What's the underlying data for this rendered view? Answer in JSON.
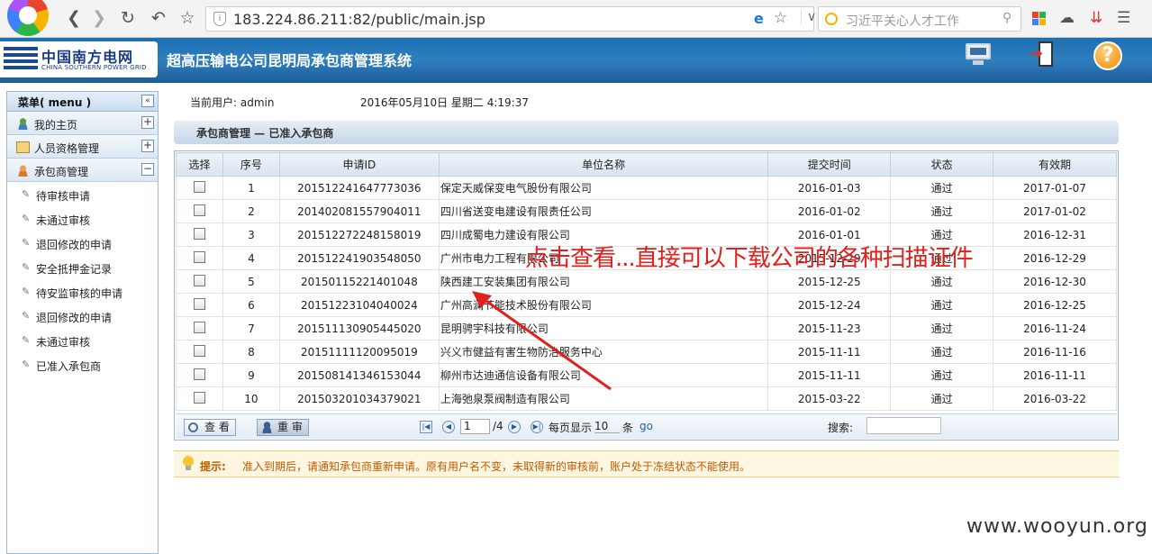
{
  "browser": {
    "url": "183.224.86.211:82/public/main.jsp",
    "search_placeholder": "习近平关心人才工作",
    "nav_back": "❮",
    "nav_forward": "❯",
    "nav_reload": "↻",
    "nav_undo": "↶",
    "nav_fav": "☆",
    "ie_mark": "e",
    "star": "☆",
    "dropdown": "∨",
    "tool_cloud": "☁",
    "tool_down": "⇊",
    "tool_menu": "☰",
    "search_mag": "⚲"
  },
  "header": {
    "brand_cn": "中国南方电网",
    "brand_en": "CHINA SOUTHERN POWER GRID",
    "system_title": "超高压输电公司昆明局承包商管理系统",
    "help_label": "?"
  },
  "sidebar": {
    "title": "菜单( menu )",
    "collapse_label": "«",
    "sections": [
      {
        "label": "我的主页",
        "toggle": "+"
      },
      {
        "label": "人员资格管理",
        "toggle": "+"
      },
      {
        "label": "承包商管理",
        "toggle": "−"
      }
    ],
    "items": [
      "待审核申请",
      "未通过审核",
      "退回修改的申请",
      "安全抵押金记录",
      "待安监审核的申请",
      "退回修改的申请",
      "未通过审核",
      "已准入承包商"
    ],
    "item_icon": "✎"
  },
  "main": {
    "current_user": "当前用户: admin",
    "datetime": "2016年05月10日 星期二 4:19:37",
    "breadcrumb": "承包商管理 — 已准入承包商",
    "columns": [
      "选择",
      "序号",
      "申请ID",
      "单位名称",
      "提交时间",
      "状态",
      "有效期"
    ],
    "rows": [
      {
        "no": "1",
        "id": "201512241647773036",
        "name": "保定天威保变电气股份有限公司",
        "submitted": "2016-01-03",
        "status": "通过",
        "valid": "2017-01-07"
      },
      {
        "no": "2",
        "id": "201402081557904011",
        "name": "四川省送变电建设有限责任公司",
        "submitted": "2016-01-02",
        "status": "通过",
        "valid": "2017-01-02"
      },
      {
        "no": "3",
        "id": "201512272248158019",
        "name": "四川成蜀电力建设有限公司",
        "submitted": "2016-01-01",
        "status": "通过",
        "valid": "2016-12-31"
      },
      {
        "no": "4",
        "id": "201512241903548050",
        "name": "广州市电力工程有限公司",
        "submitted": "2015-12-29",
        "status": "通过",
        "valid": "2016-12-29"
      },
      {
        "no": "5",
        "id": "2015011522140104 8",
        "name": "陕西建工安装集团有限公司",
        "submitted": "2015-12-25",
        "status": "通过",
        "valid": "2016-12-30"
      },
      {
        "no": "6",
        "id": "20151223104040024",
        "name": "广州高澜节能技术股份有限公司",
        "submitted": "2015-12-24",
        "status": "通过",
        "valid": "2016-12-25"
      },
      {
        "no": "7",
        "id": "201511130905445020",
        "name": "昆明骋宇科技有限公司",
        "submitted": "2015-11-23",
        "status": "通过",
        "valid": "2016-11-24"
      },
      {
        "no": "8",
        "id": "20151111120095019",
        "name": "兴义市健益有害生物防治服务中心",
        "submitted": "2015-11-11",
        "status": "通过",
        "valid": "2016-11-16"
      },
      {
        "no": "9",
        "id": "201508141346153044",
        "name": "柳州市达迪通信设备有限公司",
        "submitted": "2015-11-11",
        "status": "通过",
        "valid": "2016-11-11"
      },
      {
        "no": "10",
        "id": "201503201034379021",
        "name": "上海弛泉泵阀制造有限公司",
        "submitted": "2015-03-22",
        "status": "通过",
        "valid": "2016-03-22"
      }
    ],
    "pager": {
      "view_button": "查 看",
      "review_button": "重 审",
      "page": "1",
      "total_pages": "/4",
      "per_page_label": "每页显示",
      "per_page": "10",
      "per_page_unit": "条",
      "go": "go",
      "search_label": "搜索:",
      "first": "|◀",
      "prev": "◀",
      "next": "▶",
      "last": "▶|"
    },
    "tip_label": "提示:",
    "tip_text": "准入到期后，请通知承包商重新申请。原有用户名不变，未取得新的审核前，账户处于冻结状态不能使用。"
  },
  "annotation": {
    "text": "点击查看...直接可以下载公司的各种扫描证件",
    "color": "#e0201c"
  },
  "watermark": "www.wooyun.org"
}
